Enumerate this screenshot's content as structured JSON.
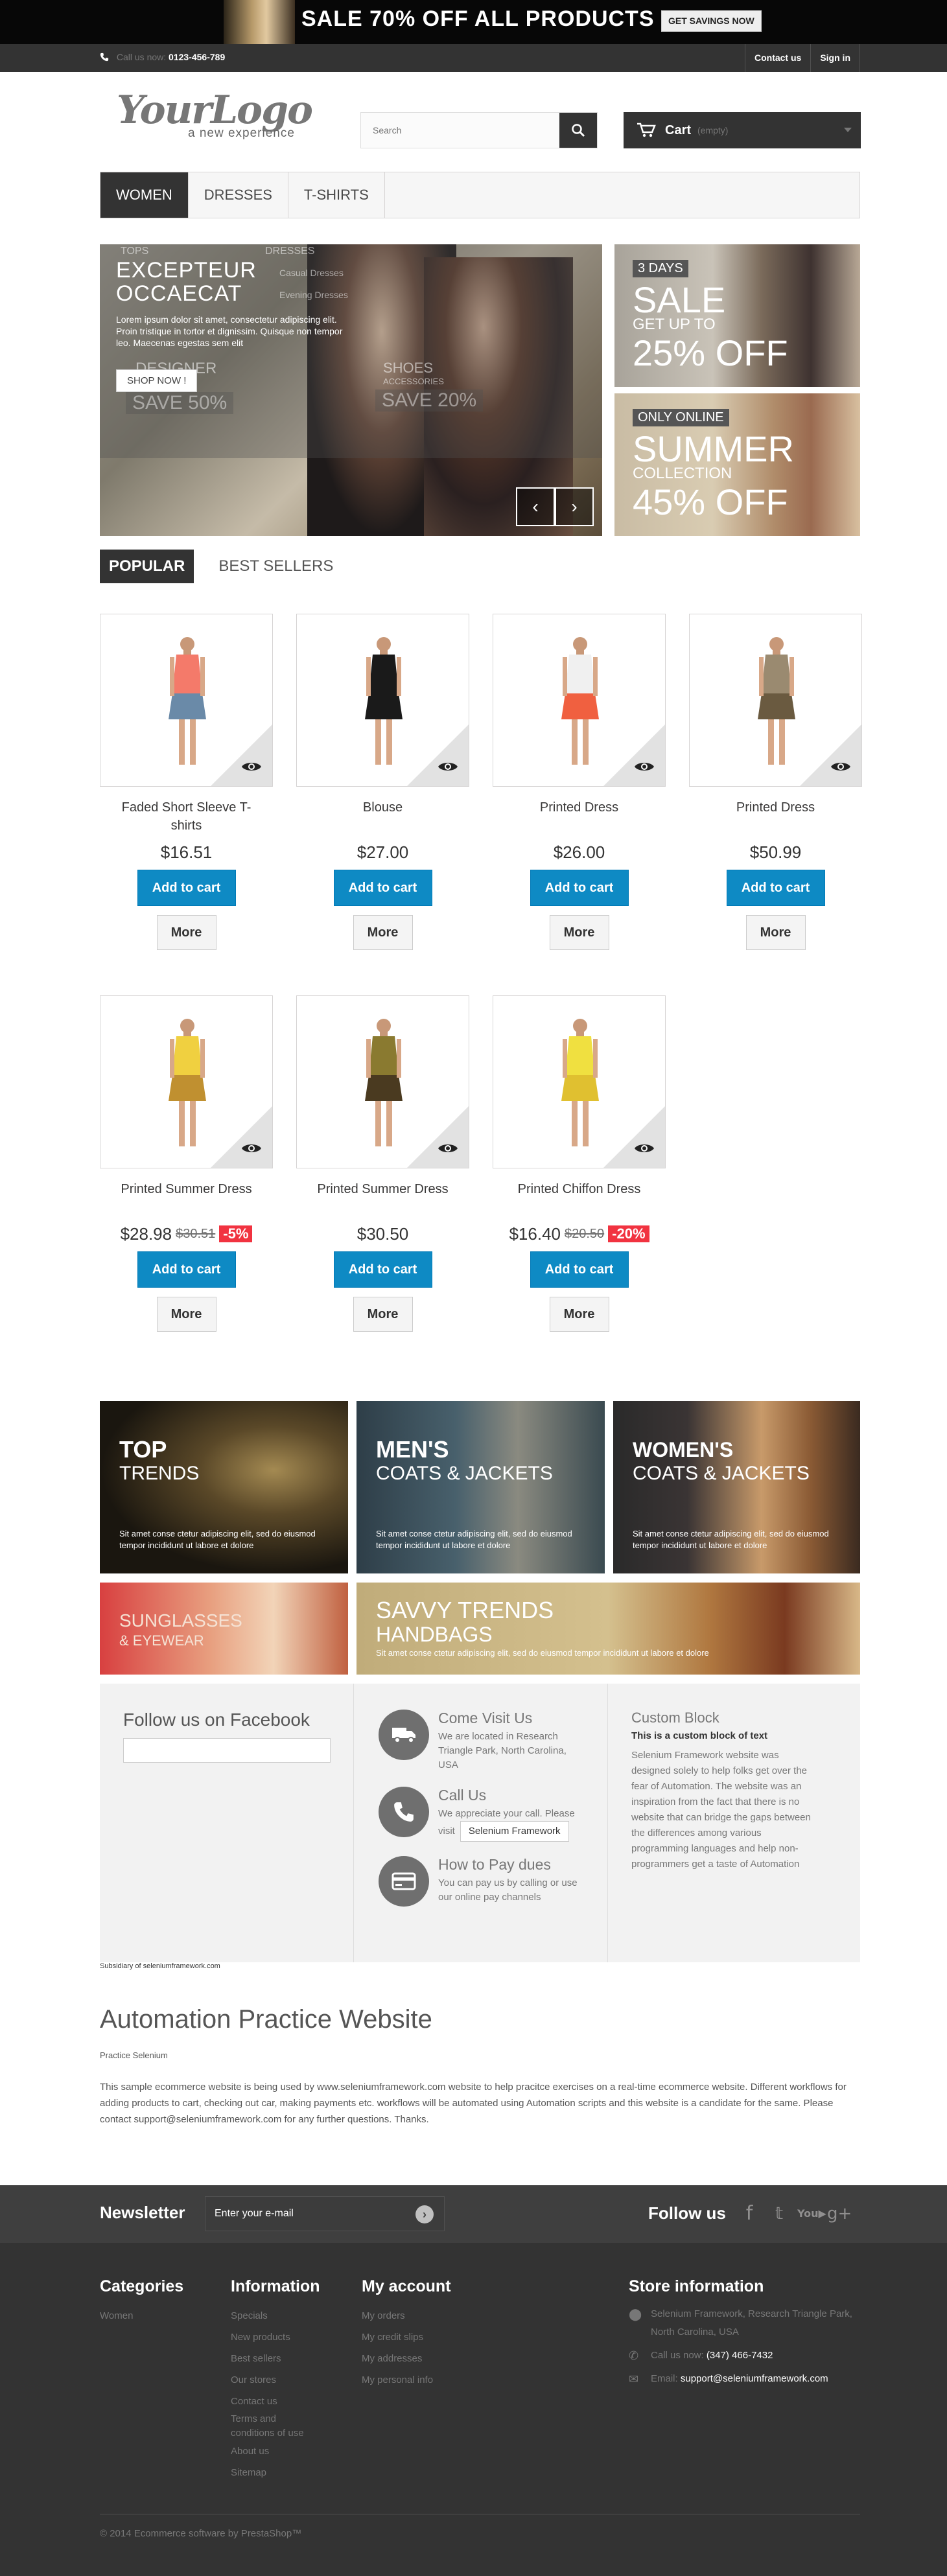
{
  "banner": {
    "sale_text": "SALE 70% OFF ALL PRODUCTS",
    "button": "GET SAVINGS NOW"
  },
  "topbar": {
    "call_label": "Call us now:",
    "phone": "0123-456-789",
    "contact": "Contact us",
    "signin": "Sign in"
  },
  "header": {
    "logo": "YourLogo",
    "logo_tagline": "a new experience",
    "search_placeholder": "Search",
    "cart_label": "Cart",
    "cart_status": "(empty)"
  },
  "menu": [
    "WOMEN",
    "DRESSES",
    "T-SHIRTS"
  ],
  "slider": {
    "heading_line1": "EXCEPTEUR",
    "heading_line2": "OCCAECAT",
    "text": "Lorem ipsum dolor sit amet, consectetur adipiscing elit. Proin tristique in tortor et dignissim. Quisque non tempor leo. Maecenas egestas sem elit",
    "button": "SHOP NOW !",
    "ghost_tops": "TOPS",
    "ghost_dresses": "DRESSES",
    "ghost_casual": "Casual Dresses",
    "ghost_evening": "Evening Dresses",
    "ghost_designer": "DESIGNER",
    "ghost_save50": "SAVE 50%",
    "ghost_shoes": "SHOES",
    "ghost_accessories": "ACCESSORIES",
    "ghost_save20": "SAVE 20%",
    "prev": "‹",
    "next": "›"
  },
  "promos": [
    {
      "tag": "3 DAYS",
      "big": "SALE",
      "mid": "GET UP TO",
      "big2": "25% OFF"
    },
    {
      "tag": "ONLY ONLINE",
      "big": "SUMMER",
      "mid": "COLLECTION",
      "big2": "45% OFF"
    }
  ],
  "tabs": [
    "POPULAR",
    "BEST SELLERS"
  ],
  "products": [
    {
      "name": "Faded Short Sleeve T-shirts",
      "price": "$16.51",
      "old": "",
      "disc": "",
      "add": "Add to cart",
      "more": "More"
    },
    {
      "name": "Blouse",
      "price": "$27.00",
      "old": "",
      "disc": "",
      "add": "Add to cart",
      "more": "More"
    },
    {
      "name": "Printed Dress",
      "price": "$26.00",
      "old": "",
      "disc": "",
      "add": "Add to cart",
      "more": "More"
    },
    {
      "name": "Printed Dress",
      "price": "$50.99",
      "old": "",
      "disc": "",
      "add": "Add to cart",
      "more": "More"
    },
    {
      "name": "Printed Summer Dress",
      "price": "$28.98",
      "old": "$30.51",
      "disc": "-5%",
      "add": "Add to cart",
      "more": "More"
    },
    {
      "name": "Printed Summer Dress",
      "price": "$30.50",
      "old": "",
      "disc": "",
      "add": "Add to cart",
      "more": "More"
    },
    {
      "name": "Printed Chiffon Dress",
      "price": "$16.40",
      "old": "$20.50",
      "disc": "-20%",
      "add": "Add to cart",
      "more": "More"
    }
  ],
  "banners": [
    {
      "t1": "TOP",
      "t2": "TRENDS",
      "text": "Sit amet conse ctetur adipiscing elit, sed do eiusmod tempor incididunt ut labore et dolore"
    },
    {
      "t1": "MEN'S",
      "t2": "COATS & JACKETS",
      "text": "Sit amet conse ctetur adipiscing elit, sed do eiusmod tempor incididunt ut labore et dolore"
    },
    {
      "t1": "WOMEN'S",
      "t2": "COATS & JACKETS",
      "text": "Sit amet conse ctetur adipiscing elit, sed do eiusmod tempor incididunt ut labore et dolore"
    },
    {
      "t1": "SUNGLASSES",
      "t2": "& EYEWEAR",
      "text": ""
    },
    {
      "t1": "SAVVY TRENDS",
      "t2": "HANDBAGS",
      "text": "Sit amet conse ctetur adipiscing elit, sed do eiusmod tempor incididunt ut labore et dolore"
    }
  ],
  "info": {
    "facebook_title": "Follow us on Facebook",
    "visit_title": "Come Visit Us",
    "visit_text": "We are located in Research Triangle Park, North Carolina, USA",
    "call_title": "Call Us",
    "call_text": "We appreciate your call. Please visit",
    "call_select": "Selenium Framework",
    "pay_title": "How to Pay dues",
    "pay_text": "You can pay us by calling or use our online pay channels",
    "custom_title": "Custom Block",
    "custom_bold": "This is a custom block of text",
    "custom_text": "Selenium Framework website was designed solely to help folks get over the fear of Automation. The website was an inspiration from the fact that there is no website that can bridge the gaps between the differences among various programming languages and help non-programmers get a taste of Automation"
  },
  "subsidiary": "Subsidiary of seleniumframework.com",
  "about": {
    "title": "Automation Practice Website",
    "subtitle": "Practice Selenium",
    "text": "This sample ecommerce website is being used by www.seleniumframework.com website to help pracitce exercises on a real-time ecommerce website. Different workflows for adding products to cart, checking out car, making payments etc. workflows will be automated using Automation scripts and this website is a candidate for the same. Please contact support@seleniumframework.com for any further questions. Thanks."
  },
  "newsletter": {
    "label": "Newsletter",
    "placeholder": "Enter your e-mail",
    "go": "›",
    "follow": "Follow us"
  },
  "footer": {
    "categories_title": "Categories",
    "categories": [
      "Women"
    ],
    "info_title": "Information",
    "info_links": [
      "Specials",
      "New products",
      "Best sellers",
      "Our stores",
      "Contact us",
      "Terms and",
      "conditions of use",
      "About us",
      "Sitemap"
    ],
    "account_title": "My account",
    "account_links": [
      "My orders",
      "My credit slips",
      "My addresses",
      "My personal info"
    ],
    "store_title": "Store information",
    "store_address": "Selenium Framework, Research Triangle Park, North Carolina, USA",
    "store_call_label": "Call us now:",
    "store_phone": "(347) 466-7432",
    "store_email_label": "Email:",
    "store_email": "support@seleniumframework.com",
    "copyright": "© 2014 Ecommerce software by PrestaShop™"
  },
  "colors": {
    "dark": "#333333",
    "button_blue": "#0e8ac4",
    "discount_red": "#f13340"
  }
}
